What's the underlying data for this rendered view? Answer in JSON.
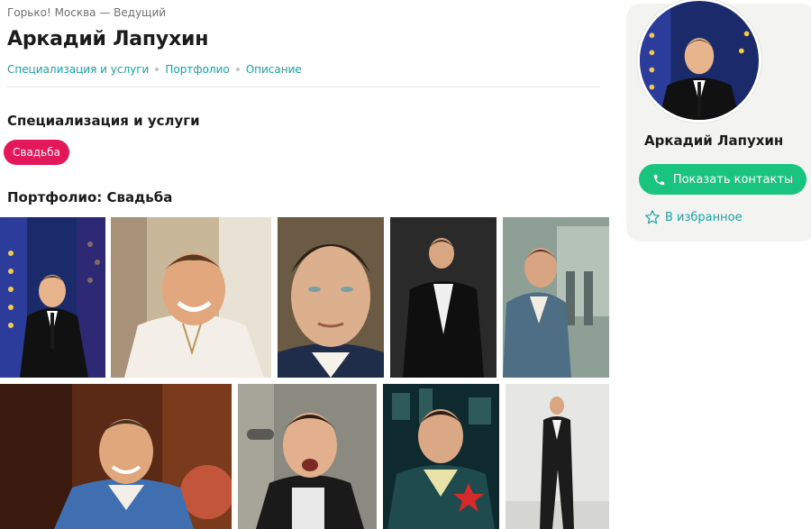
{
  "header": {
    "breadcrumb": "Горько! Москва — Ведущий",
    "title": "Аркадий Лапухин",
    "anchors": [
      "Специализация и услуги",
      "Портфолио",
      "Описание"
    ]
  },
  "services": {
    "heading": "Специализация и услуги",
    "tags": [
      "Свадьба"
    ]
  },
  "portfolio": {
    "heading": "Портфолио: Свадьба",
    "photos": [
      "photo-stage-suit",
      "photo-smiling-white-shirt",
      "photo-face-closeup",
      "photo-black-jacket-dark",
      "photo-blue-jacket-street",
      "photo-blue-jacket-laughing",
      "photo-microphone",
      "photo-green-jacket-badge",
      "photo-full-length-suit"
    ]
  },
  "sidebar": {
    "name": "Аркадий Лапухин",
    "contacts_label": "Показать контакты",
    "favorites_label": "В избранное"
  },
  "colors": {
    "link": "#1aa3a3",
    "tag": "#e2185b",
    "cta": "#19c47e",
    "panel": "#f3f3f1"
  },
  "icons": [
    "phone-icon",
    "star-icon"
  ]
}
